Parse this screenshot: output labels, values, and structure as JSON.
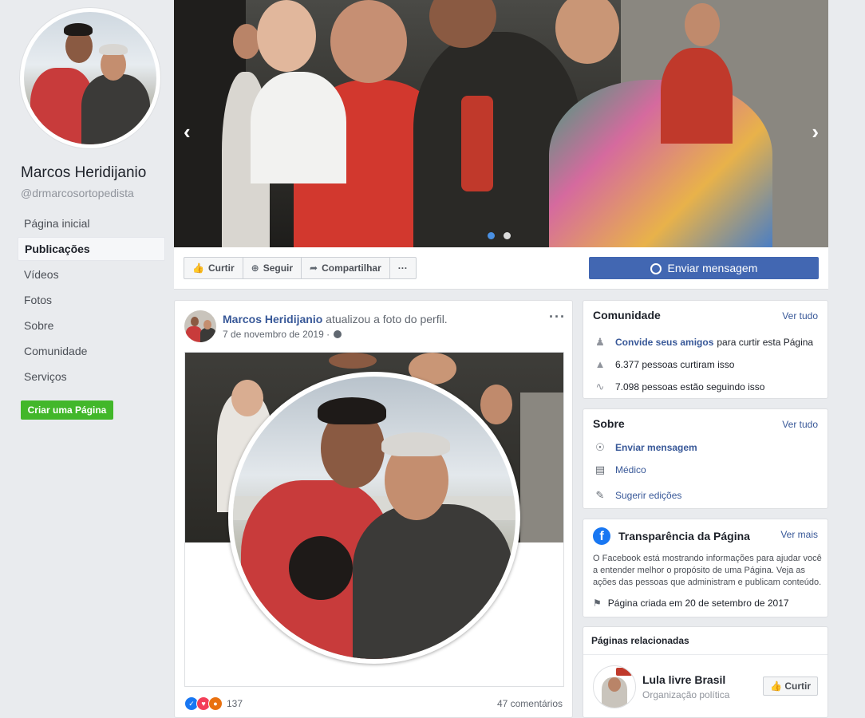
{
  "sidebar": {
    "page_name": "Marcos Heridijanio",
    "handle": "@drmarcosortopedista",
    "nav": [
      {
        "label": "Página inicial"
      },
      {
        "label": "Publicações"
      },
      {
        "label": "Vídeos"
      },
      {
        "label": "Fotos"
      },
      {
        "label": "Sobre"
      },
      {
        "label": "Comunidade"
      },
      {
        "label": "Serviços"
      }
    ],
    "create_page_label": "Criar uma Página"
  },
  "cover": {
    "prev_icon": "chevron-left-icon",
    "next_icon": "chevron-right-icon",
    "slide_count": 2,
    "active_slide": 1
  },
  "actions": {
    "like_label": "Curtir",
    "follow_label": "Seguir",
    "share_label": "Compartilhar",
    "more_label": "···",
    "message_label": "Enviar mensagem"
  },
  "post": {
    "author": "Marcos Heridijanio",
    "action_text": "atualizou a foto do perfil.",
    "date": "7 de novembro de 2019 ·",
    "visibility_icon": "globe-icon",
    "more_label": "···",
    "reaction_count": "137",
    "comments": "47 comentários"
  },
  "community": {
    "title": "Comunidade",
    "see_all": "Ver tudo",
    "invite_link": "Convide seus amigos",
    "invite_text": "para curtir esta Página",
    "likes_text": "6.377 pessoas curtiram isso",
    "followers_text": "7.098 pessoas estão seguindo isso"
  },
  "about": {
    "title": "Sobre",
    "see_all": "Ver tudo",
    "message_link": "Enviar mensagem",
    "category": "Médico",
    "suggest_edits": "Sugerir edições"
  },
  "transparency": {
    "title": "Transparência da Página",
    "see_more": "Ver mais",
    "text": "O Facebook está mostrando informações para ajudar você a entender melhor o propósito de uma Página. Veja as ações das pessoas que administram e publicam conteúdo.",
    "created": "Página criada em 20 de setembro de 2017"
  },
  "related": {
    "title": "Páginas relacionadas",
    "name": "Lula livre Brasil",
    "category": "Organização política",
    "like_label": "Curtir"
  },
  "colors": {
    "brand_blue": "#4267b2",
    "link_blue": "#385898",
    "green": "#42b72a",
    "background": "#e9ebee"
  }
}
